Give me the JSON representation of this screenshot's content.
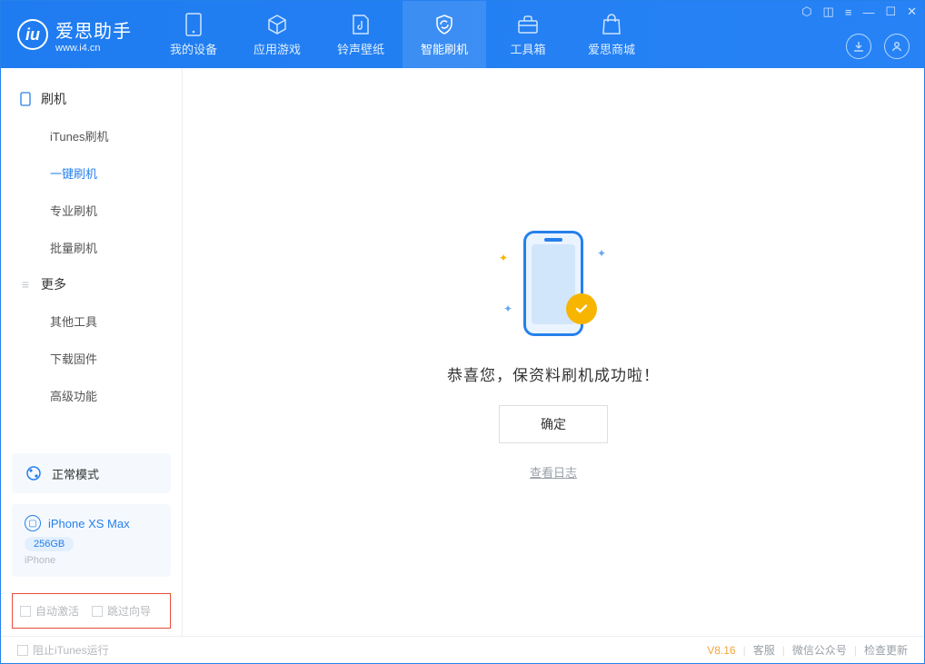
{
  "app": {
    "name_cn": "爱思助手",
    "url": "www.i4.cn"
  },
  "nav": {
    "items": [
      {
        "label": "我的设备"
      },
      {
        "label": "应用游戏"
      },
      {
        "label": "铃声壁纸"
      },
      {
        "label": "智能刷机"
      },
      {
        "label": "工具箱"
      },
      {
        "label": "爱思商城"
      }
    ],
    "active_index": 3
  },
  "sidebar": {
    "group1": {
      "title": "刷机",
      "items": [
        {
          "label": "iTunes刷机"
        },
        {
          "label": "一键刷机"
        },
        {
          "label": "专业刷机"
        },
        {
          "label": "批量刷机"
        }
      ],
      "active_index": 1
    },
    "group2": {
      "title": "更多",
      "items": [
        {
          "label": "其他工具"
        },
        {
          "label": "下载固件"
        },
        {
          "label": "高级功能"
        }
      ]
    },
    "status": {
      "label": "正常模式"
    },
    "device": {
      "name": "iPhone XS Max",
      "storage": "256GB",
      "type": "iPhone"
    },
    "bottom_checks": {
      "auto_activate": "自动激活",
      "skip_guide": "跳过向导"
    }
  },
  "main": {
    "success_msg": "恭喜您，保资料刷机成功啦！",
    "confirm_btn": "确定",
    "view_log": "查看日志"
  },
  "footer": {
    "block_itunes": "阻止iTunes运行",
    "version": "V8.16",
    "links": {
      "support": "客服",
      "wechat": "微信公众号",
      "check_update": "检查更新"
    }
  }
}
